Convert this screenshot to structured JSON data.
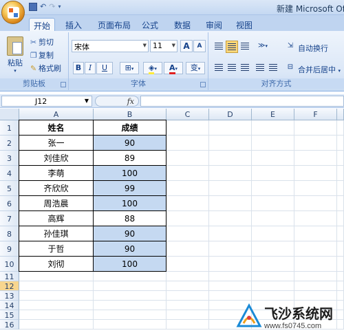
{
  "title_bar": {
    "title": "新建 Microsoft Offic"
  },
  "tabs": [
    {
      "label": "开始",
      "active": true
    },
    {
      "label": "插入"
    },
    {
      "label": "页面布局"
    },
    {
      "label": "公式"
    },
    {
      "label": "数据"
    },
    {
      "label": "审阅"
    },
    {
      "label": "视图"
    }
  ],
  "clipboard": {
    "paste_label": "粘贴",
    "cut_label": "剪切",
    "copy_label": "复制",
    "format_painter_label": "格式刷",
    "group_label": "剪贴板"
  },
  "font": {
    "font_name": "宋体",
    "font_size": "11",
    "grow_label": "A",
    "shrink_label": "A",
    "bold_label": "B",
    "italic_label": "I",
    "underline_label": "U",
    "font_color_label": "A",
    "phonetic_label": "变",
    "group_label": "字体"
  },
  "alignment": {
    "wrap_text_label": "自动换行",
    "merge_center_label": "合并后居中",
    "group_label": "对齐方式"
  },
  "formula_bar": {
    "name_box": "J12",
    "fx_label": "fx"
  },
  "grid": {
    "columns": [
      "A",
      "B",
      "C",
      "D",
      "E",
      "F"
    ],
    "rows": [
      "1",
      "2",
      "3",
      "4",
      "5",
      "6",
      "7",
      "8",
      "9",
      "10",
      "11",
      "12",
      "13",
      "14",
      "15",
      "16"
    ],
    "selected_row": "12",
    "table": [
      [
        "姓名",
        "成绩"
      ],
      [
        "张一",
        "90"
      ],
      [
        "刘佳欣",
        "89"
      ],
      [
        "李萌",
        "100"
      ],
      [
        "齐欣欣",
        "99"
      ],
      [
        "周浩晨",
        "100"
      ],
      [
        "高辉",
        "88"
      ],
      [
        "孙佳琪",
        "90"
      ],
      [
        "于哲",
        "90"
      ],
      [
        "刘彻",
        "100"
      ]
    ],
    "highlight_color": "#c5d9f1"
  },
  "watermark": {
    "title": "飞沙系统网",
    "url": "www.fs0745.com"
  }
}
